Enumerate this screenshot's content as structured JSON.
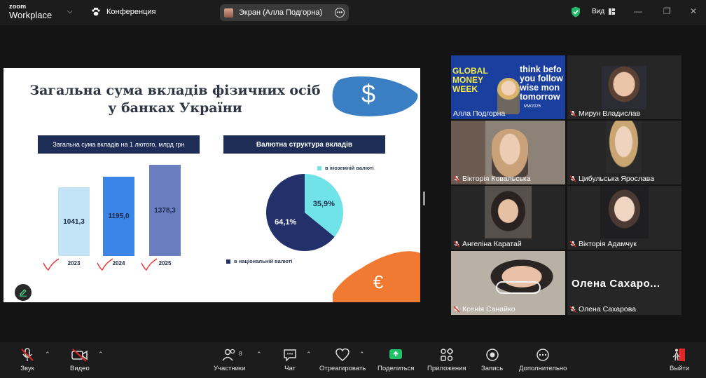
{
  "app": {
    "logo_line1": "zoom",
    "logo_line2": "Workplace",
    "meeting_title": "Конференция"
  },
  "share_pill": {
    "label": "Экран (Алла Подгорна)"
  },
  "header": {
    "view_label": "Вид"
  },
  "slide": {
    "title": "Загальна сума вкладів фізичних осіб у банках України",
    "dollar_symbol": "$",
    "bar_header": "Загальна сума вкладів на 1 лютого, млрд грн",
    "pie_header": "Валютна структура вкладів",
    "legend_foreign": "в іноземній валюті",
    "legend_national": "в національній валюті",
    "pie_label_foreign": "35,9%",
    "pie_label_national": "64,1%"
  },
  "chart_data": [
    {
      "type": "bar",
      "categories": [
        "2023",
        "2024",
        "2025"
      ],
      "values": [
        1041.3,
        1195.0,
        1378.3
      ],
      "value_labels": [
        "1041,3",
        "1195,0",
        "1378,3"
      ],
      "title": "Загальна сума вкладів на 1 лютого, млрд грн",
      "colors": [
        "#c3e4f7",
        "#3a86e8",
        "#6b7fc0"
      ]
    },
    {
      "type": "pie",
      "title": "Валютна структура вкладів",
      "labels": [
        "в іноземній валюті",
        "в національній валюті"
      ],
      "values": [
        35.9,
        64.1
      ],
      "colors": [
        "#6fe3e8",
        "#24306a"
      ]
    }
  ],
  "participants": [
    {
      "name": "Алла Подгорна",
      "muted": false,
      "banner": [
        "think befo",
        "you follow",
        "wise mon",
        "tomorrow"
      ],
      "banner_left": [
        "GLOBAL",
        "MONEY",
        "WEEK"
      ],
      "banner_tag": "MW2025"
    },
    {
      "name": "Мирун Владислав",
      "muted": true
    },
    {
      "name": "Вікторія Ковальська",
      "muted": true
    },
    {
      "name": "Цибульська Ярослава",
      "muted": true
    },
    {
      "name": "Ангеліна Каратай",
      "muted": true
    },
    {
      "name": "Вікторія Адамчук",
      "muted": true
    },
    {
      "name": "Ксенія Санайко",
      "muted": true
    },
    {
      "name": "Олена Сахарова",
      "muted": true,
      "display_name": "Олена  Сахаро..."
    }
  ],
  "toolbar": {
    "audio": "Звук",
    "video": "Видео",
    "participants": "Участники",
    "participants_count": "8",
    "chat": "Чат",
    "react": "Отреагировать",
    "share": "Поделиться",
    "apps": "Приложения",
    "record": "Запись",
    "more": "Дополнительно",
    "leave": "Выйти"
  },
  "colors": {
    "accent_green": "#2fd07e",
    "slide_navy": "#1d2d55",
    "leave_red": "#e02828"
  }
}
